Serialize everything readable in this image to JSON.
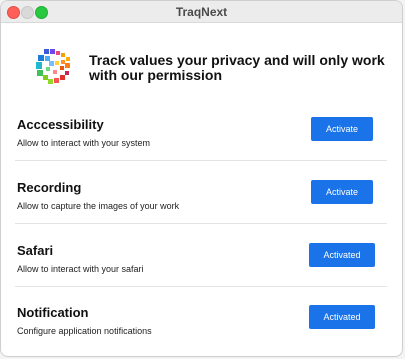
{
  "window": {
    "title": "TraqNext"
  },
  "header": {
    "headline": "Track values your privacy and will only work with our permission"
  },
  "permissions": [
    {
      "title": "Acccessibility",
      "description": "Allow to interact with your system",
      "button": "Activate"
    },
    {
      "title": "Recording",
      "description": "Allow to capture the images of your work",
      "button": "Activate"
    },
    {
      "title": "Safari",
      "description": "Allow to interact with your safari",
      "button": "Activated"
    },
    {
      "title": "Notification",
      "description": "Configure application notifications",
      "button": "Activated"
    }
  ],
  "colors": {
    "accent": "#1a73e8"
  }
}
